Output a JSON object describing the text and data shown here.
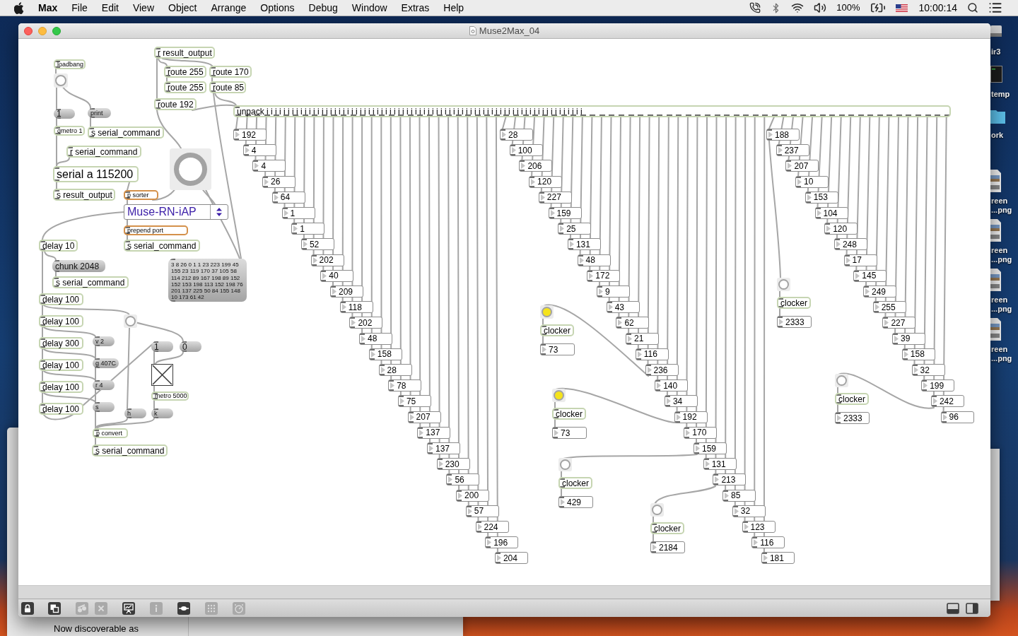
{
  "menu_bar": {
    "app_name": "Max",
    "menus": [
      "File",
      "Edit",
      "View",
      "Object",
      "Arrange",
      "Options",
      "Debug",
      "Window",
      "Extras",
      "Help"
    ],
    "battery": "100%",
    "clock": "10:00:14"
  },
  "window": {
    "title": "Muse2Max_04"
  },
  "patch": {
    "objects": [
      {
        "kind": "object",
        "text": "loadbang"
      },
      {
        "kind": "bang",
        "lit": false
      },
      {
        "kind": "message",
        "text": "1"
      },
      {
        "kind": "message",
        "text": "print"
      },
      {
        "kind": "object",
        "text": "qmetro 1"
      },
      {
        "kind": "object",
        "text": "s serial_command"
      },
      {
        "kind": "object",
        "text": "r serial_command"
      },
      {
        "kind": "object",
        "text": "serial a 115200"
      },
      {
        "kind": "object",
        "text": "s result_output"
      },
      {
        "kind": "object",
        "text": "p sorter",
        "color": "#d4914b"
      },
      {
        "kind": "bang",
        "lit": false
      },
      {
        "kind": "menu",
        "text": "Muse-RN-iAP"
      },
      {
        "kind": "object",
        "text": "prepend port",
        "color": "#d4914b"
      },
      {
        "kind": "object",
        "text": "s serial_command"
      },
      {
        "kind": "message",
        "text": "3 8 26 0 1 1 23 223 199 45 155 23 119 170 37 105 58 114 212 89 167 198 89 152 152 153 198 113 152 198 76 201 137 225 50 84 155 148 10 173 61 42"
      },
      {
        "kind": "object",
        "text": "delay 10"
      },
      {
        "kind": "message",
        "text": "chunk 2048"
      },
      {
        "kind": "object",
        "text": "s serial_command"
      },
      {
        "kind": "object",
        "text": "delay 100"
      },
      {
        "kind": "object",
        "text": "delay 100"
      },
      {
        "kind": "object",
        "text": "delay 300"
      },
      {
        "kind": "object",
        "text": "delay 100"
      },
      {
        "kind": "object",
        "text": "delay 100"
      },
      {
        "kind": "object",
        "text": "delay 100"
      },
      {
        "kind": "bang",
        "lit": false
      },
      {
        "kind": "message",
        "text": "v 2"
      },
      {
        "kind": "message",
        "text": "g 407C"
      },
      {
        "kind": "message",
        "text": "r 4"
      },
      {
        "kind": "message",
        "text": "s"
      },
      {
        "kind": "message",
        "text": "1"
      },
      {
        "kind": "message",
        "text": "0"
      },
      {
        "kind": "toggle",
        "checked": true
      },
      {
        "kind": "object",
        "text": "metro 5000"
      },
      {
        "kind": "message",
        "text": "h"
      },
      {
        "kind": "message",
        "text": "k"
      },
      {
        "kind": "object",
        "text": "p convert"
      },
      {
        "kind": "object",
        "text": "s serial_command"
      },
      {
        "kind": "object",
        "text": "r result_output"
      },
      {
        "kind": "object",
        "text": "route 255"
      },
      {
        "kind": "object",
        "text": "route 170"
      },
      {
        "kind": "object",
        "text": "route 255"
      },
      {
        "kind": "object",
        "text": "route 85"
      },
      {
        "kind": "object",
        "text": "route 192"
      },
      {
        "kind": "object",
        "text": "unpack i i i i i i i i i i i i i i i i i i i i i i i i i i i i i i i i i i i i i i i i i i i i i i i i i i i i i i i i i i i i i i i i i i i i i i i i i i i"
      }
    ],
    "number_columns": [
      [
        "192",
        "4",
        "4",
        "26",
        "64",
        "1",
        "1",
        "52",
        "202",
        "40",
        "209",
        "118",
        "202",
        "48",
        "158",
        "28",
        "78",
        "75",
        "207",
        "137",
        "137",
        "230",
        "56",
        "200",
        "57",
        "224",
        "196",
        "204"
      ],
      [
        "28",
        "100",
        "206",
        "120",
        "227",
        "159",
        "25",
        "131",
        "48",
        "172",
        "9",
        "43",
        "62",
        "21",
        "116",
        "236",
        "140",
        "34",
        "192",
        "170",
        "159",
        "131",
        "213",
        "85",
        "32",
        "123",
        "116",
        "181"
      ],
      [
        "188",
        "237",
        "207",
        "10",
        "153",
        "104",
        "120",
        "248",
        "17",
        "145",
        "249",
        "255",
        "227",
        "39",
        "158",
        "32",
        "199",
        "242",
        "96"
      ]
    ],
    "clockers": [
      {
        "lit": true,
        "label": "clocker",
        "value": "73"
      },
      {
        "lit": true,
        "label": "clocker",
        "value": "73"
      },
      {
        "lit": false,
        "label": "clocker",
        "value": "429"
      },
      {
        "lit": false,
        "label": "clocker",
        "value": "2184"
      },
      {
        "lit": false,
        "label": "clocker",
        "value": "2333"
      },
      {
        "lit": false,
        "label": "clocker",
        "value": "2333"
      }
    ]
  },
  "toolbar": {
    "buttons": [
      {
        "disabled": false
      },
      {
        "disabled": false
      },
      {
        "disabled": true
      },
      {
        "disabled": true
      },
      {
        "disabled": false
      },
      {
        "disabled": true
      },
      {
        "disabled": false
      },
      {
        "disabled": true
      },
      {
        "disabled": true
      },
      {
        "disabled": false
      },
      {
        "disabled": false
      }
    ]
  },
  "desktop_icons": [
    {
      "kind": "drive",
      "label": [
        "ir3"
      ]
    },
    {
      "kind": "screen",
      "label": [
        "temp"
      ]
    },
    {
      "kind": "folder",
      "label": [
        "ork"
      ]
    },
    {
      "kind": "image",
      "label": [
        "reen",
        "...png"
      ]
    },
    {
      "kind": "image",
      "label": [
        "reen",
        "...png"
      ]
    },
    {
      "kind": "image",
      "label": [
        "reen",
        "...png"
      ]
    },
    {
      "kind": "image",
      "label": [
        "reen",
        "...png"
      ]
    }
  ],
  "background_window": {
    "text": "Now discoverable as"
  }
}
